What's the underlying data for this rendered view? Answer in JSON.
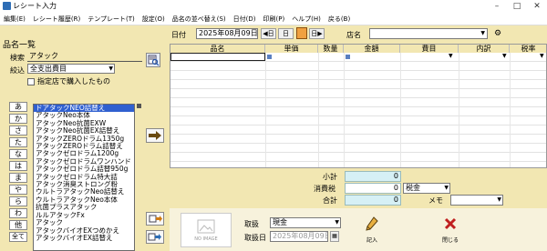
{
  "window": {
    "title": "レシート入力"
  },
  "menu": [
    "編集(E)",
    "レシート履歴(R)",
    "テンプレート(T)",
    "設定(O)",
    "品名の並べ替え(S)",
    "日付(D)",
    "印刷(P)",
    "ヘルプ(H)",
    "戻る(B)"
  ],
  "left": {
    "section_title": "品名一覧",
    "search_label": "検索",
    "search_value": "アタック",
    "filter_label": "絞込",
    "filter_value": "全支出費目",
    "store_checkbox_label": "指定店で購入したもの",
    "kana": [
      "あ",
      "か",
      "さ",
      "た",
      "な",
      "は",
      "ま",
      "や",
      "ら",
      "わ",
      "他",
      "全て"
    ],
    "items": [
      "ドアタックNEO詰替え",
      "アタックNeo本体",
      "アタックNeo抗菌EXW",
      "アタックNeo抗菌EX詰替え",
      "アタックZEROドラム1350g",
      "アタックZEROドラム詰替え",
      "アタックゼロドラム1200g",
      "アタックゼロドラムワンハンド",
      "アタックゼロドラム詰替950g",
      "アタックゼロドラム特大詰",
      "アタック消臭ストロング粉",
      "ウルトラアタックNeo詰替え",
      "ウルトラアタックNeo本体",
      "抗菌プラスアタック",
      "ルルアタックFx",
      "アタック",
      "アタックバイオEXつめかえ",
      "アタックバイオEX詰替え"
    ]
  },
  "header": {
    "date_label": "日付",
    "date_value": "2025年08月09日",
    "store_label": "店名",
    "store_value": ""
  },
  "grid": {
    "columns": [
      "品名",
      "単価",
      "数量",
      "金額",
      "費目",
      "内訳",
      "税率"
    ]
  },
  "summary": {
    "subtotal_label": "小計",
    "subtotal_value": "0",
    "tax_label": "消費税",
    "tax_value": "0",
    "tax_mode": "税金",
    "total_label": "合計",
    "total_value": "0",
    "memo_label": "メモ"
  },
  "bottom": {
    "noimage": "NO IMAGE",
    "handling_label": "取扱",
    "handling_value": "現金",
    "handling_date_label": "取扱日",
    "handling_date_value": "2025年08月09日",
    "entry_button": "記入",
    "close_button": "閉じる"
  }
}
